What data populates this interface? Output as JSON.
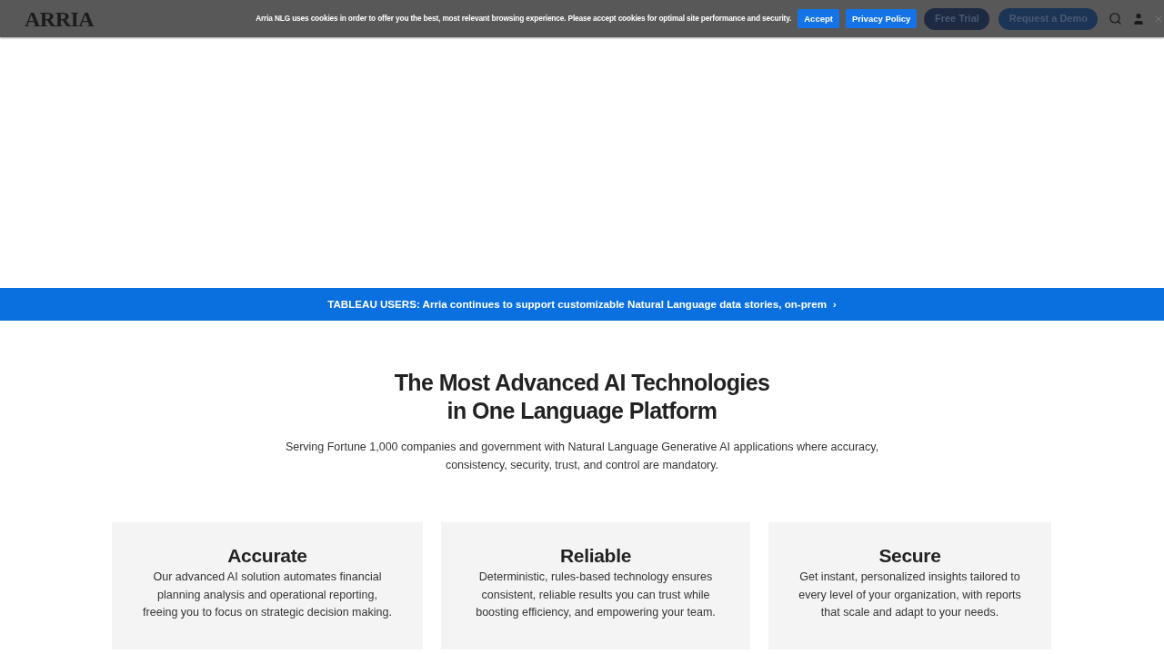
{
  "header": {
    "logo": "ARRIA",
    "cookie_notice": {
      "text": "Arria NLG uses cookies in order to offer you the best, most relevant browsing experience. Please accept cookies for optimal site performance and security.",
      "buttons": [
        {
          "label": "Accept"
        },
        {
          "label": "Privacy Policy"
        }
      ]
    },
    "buttons": [
      {
        "label": "Free Trial"
      },
      {
        "label": "Request a Demo"
      }
    ]
  },
  "banner": {
    "text": "TABLEAU USERS: Arria continues to support customizable Natural Language data stories, on-prem",
    "arrow": "›"
  },
  "hero": {
    "title_lines": [
      "The Most Advanced AI Technologies",
      "in One Language Platform"
    ],
    "subtitle": "Serving Fortune 1,000 companies and government with Natural Language Generative AI applications where accuracy, consistency, security, trust, and control are mandatory."
  },
  "cards": [
    {
      "title": "Accurate",
      "text": "Our advanced AI solution automates financial planning analysis and operational reporting, freeing you to focus on strategic decision making."
    },
    {
      "title": "Reliable",
      "text": "Deterministic, rules-based technology ensures consistent, reliable results you can trust while boosting efficiency, and empowering your team."
    },
    {
      "title": "Secure",
      "text": "Get instant, personalized insights tailored to every level of your organization, with reports that scale and adapt to your needs."
    }
  ]
}
